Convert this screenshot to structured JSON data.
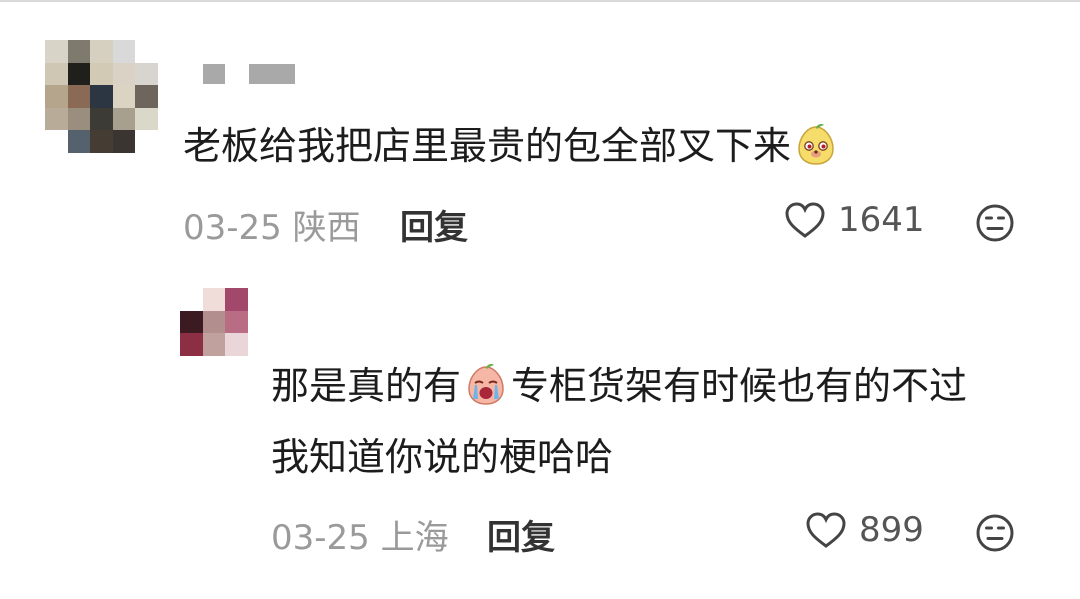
{
  "comments": [
    {
      "username_blurred": true,
      "text": "老板给我把店里最贵的包全部叉下来",
      "emoji": "pear-face-emoji",
      "date": "03-25",
      "location": "陕西",
      "reply_label": "回复",
      "likes": "1641",
      "avatar_pixels": [
        "#d8d4c8",
        "#7e7a6e",
        "#d6d0c0",
        "#d9d9d9",
        "#ffffff",
        "#cfc7b4",
        "#1f1f1c",
        "#d2cab4",
        "#d9d2c5",
        "#d8d4cf",
        "#b5a58c",
        "#8a6a54",
        "#2b3642",
        "#dcd4c2",
        "#6e655c",
        "#b8ab98",
        "#9a8f7f",
        "#3c3b36",
        "#a8a08f",
        "#dad8c8",
        "#ffffff",
        "#55616c",
        "#453d33",
        "#3a3530",
        "#ffffff"
      ]
    }
  ],
  "replies": [
    {
      "text_line1_a": "那是真的有",
      "text_line1_b": "专柜货架有时候也有的不过",
      "text_line2": "我知道你说的梗哈哈",
      "emoji": "crying-pear-emoji",
      "date": "03-25",
      "location": "上海",
      "reply_label": "回复",
      "likes": "899",
      "avatar_pixels": [
        "#ffffff",
        "#f0dcd8",
        "#a2486a",
        "#3b1a22",
        "#b38e8e",
        "#b86d84",
        "#8c2f45",
        "#c0a19e",
        "#ead6d9"
      ]
    }
  ],
  "icons": {
    "like": "heart-outline-icon",
    "dislike": "dislike-face-icon"
  },
  "colors": {
    "text": "#1c1c1c",
    "meta": "#9a9a9a",
    "reply_button": "#333333"
  }
}
